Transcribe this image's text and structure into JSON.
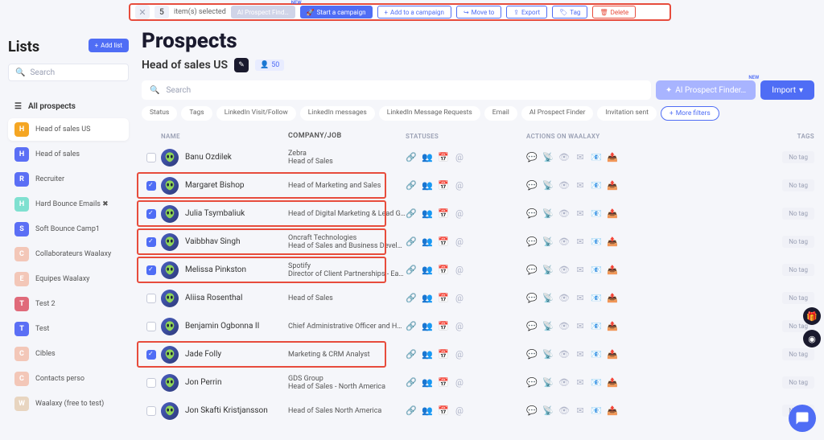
{
  "selection_bar": {
    "count": "5",
    "items_selected": "item(s) selected",
    "ai_prospect": "AI Prospect Find…",
    "new_badge": "NEW",
    "start_campaign": "Start a campaign",
    "add_to_campaign": "Add to a campaign",
    "move_to": "Move to",
    "export": "Export",
    "tag": "Tag",
    "delete": "Delete"
  },
  "sidebar": {
    "title": "Lists",
    "add_list": "Add list",
    "search_placeholder": "Search",
    "all_prospects": "All prospects",
    "items": [
      {
        "initial": "H",
        "color": "#f5a623",
        "label": "Head of sales US",
        "active": true
      },
      {
        "initial": "H",
        "color": "#5b6ff5",
        "label": "Head of sales"
      },
      {
        "initial": "R",
        "color": "#5b6ff5",
        "label": "Recruiter"
      },
      {
        "initial": "H",
        "color": "#7fe0d0",
        "label": "Hard Bounce Emails ✖"
      },
      {
        "initial": "S",
        "color": "#5b6ff5",
        "label": "Soft Bounce Camp1"
      },
      {
        "initial": "C",
        "color": "#f3c7b8",
        "label": "Collaborateurs Waalaxy"
      },
      {
        "initial": "E",
        "color": "#f3c7b8",
        "label": "Equipes Waalaxy"
      },
      {
        "initial": "T",
        "color": "#e06a7a",
        "label": "Test 2"
      },
      {
        "initial": "T",
        "color": "#5b6ff5",
        "label": "Test"
      },
      {
        "initial": "C",
        "color": "#f3c7b8",
        "label": "Cibles"
      },
      {
        "initial": "C",
        "color": "#f3c7b8",
        "label": "Contacts perso"
      },
      {
        "initial": "W",
        "color": "#e8d5c0",
        "label": "Waalaxy (free to test)"
      }
    ]
  },
  "main": {
    "title": "Prospects",
    "subtitle": "Head of sales US",
    "count": "50",
    "search_placeholder": "Search",
    "ai_finder": "AI Prospect Finder…",
    "new_badge": "NEW",
    "import": "Import",
    "filters": [
      "Status",
      "Tags",
      "LinkedIn Visit/Follow",
      "LinkedIn messages",
      "LinkedIn Message Requests",
      "Email",
      "AI Prospect Finder",
      "Invitation sent"
    ],
    "more_filters": "More filters"
  },
  "table": {
    "headers": {
      "name": "NAME",
      "company": "COMPANY/JOB",
      "statuses": "STATUSES",
      "actions": "ACTIONS ON WAALAXY",
      "tags": "TAGS"
    },
    "no_tag": "No tag",
    "rows": [
      {
        "checked": false,
        "name": "Banu Ozdilek",
        "company": "Zebra",
        "job": "Head of Sales",
        "hl": false
      },
      {
        "checked": true,
        "name": "Margaret Bishop",
        "company": "",
        "job": "Head of Marketing and Sales",
        "hl": true
      },
      {
        "checked": true,
        "name": "Julia Tsymbaliuk",
        "company": "",
        "job": "Head of Digital Marketing & Lead Genera…",
        "hl": true
      },
      {
        "checked": true,
        "name": "Vaibbhav Singh",
        "company": "Oncraft Technologies",
        "job": "Head of Sales and Business Development",
        "hl": true
      },
      {
        "checked": true,
        "name": "Melissa Pinkston",
        "company": "Spotify",
        "job": "Director of Client Partnerships - East at …",
        "hl": true
      },
      {
        "checked": false,
        "name": "Aliisa Rosenthal",
        "company": "",
        "job": "Head of Sales",
        "hl": false
      },
      {
        "checked": false,
        "name": "Benjamin Ogbonna II",
        "company": "",
        "job": "Chief Administrative Officer and Head of …",
        "hl": false
      },
      {
        "checked": true,
        "name": "Jade Folly",
        "company": "",
        "job": "Marketing & CRM Analyst",
        "hl": true
      },
      {
        "checked": false,
        "name": "Jon Perrin",
        "company": "GDS Group",
        "job": "Head of Sales - North America",
        "hl": false
      },
      {
        "checked": false,
        "name": "Jon Skafti Kristjansson",
        "company": "",
        "job": "Head of Sales North America",
        "hl": false
      }
    ]
  }
}
